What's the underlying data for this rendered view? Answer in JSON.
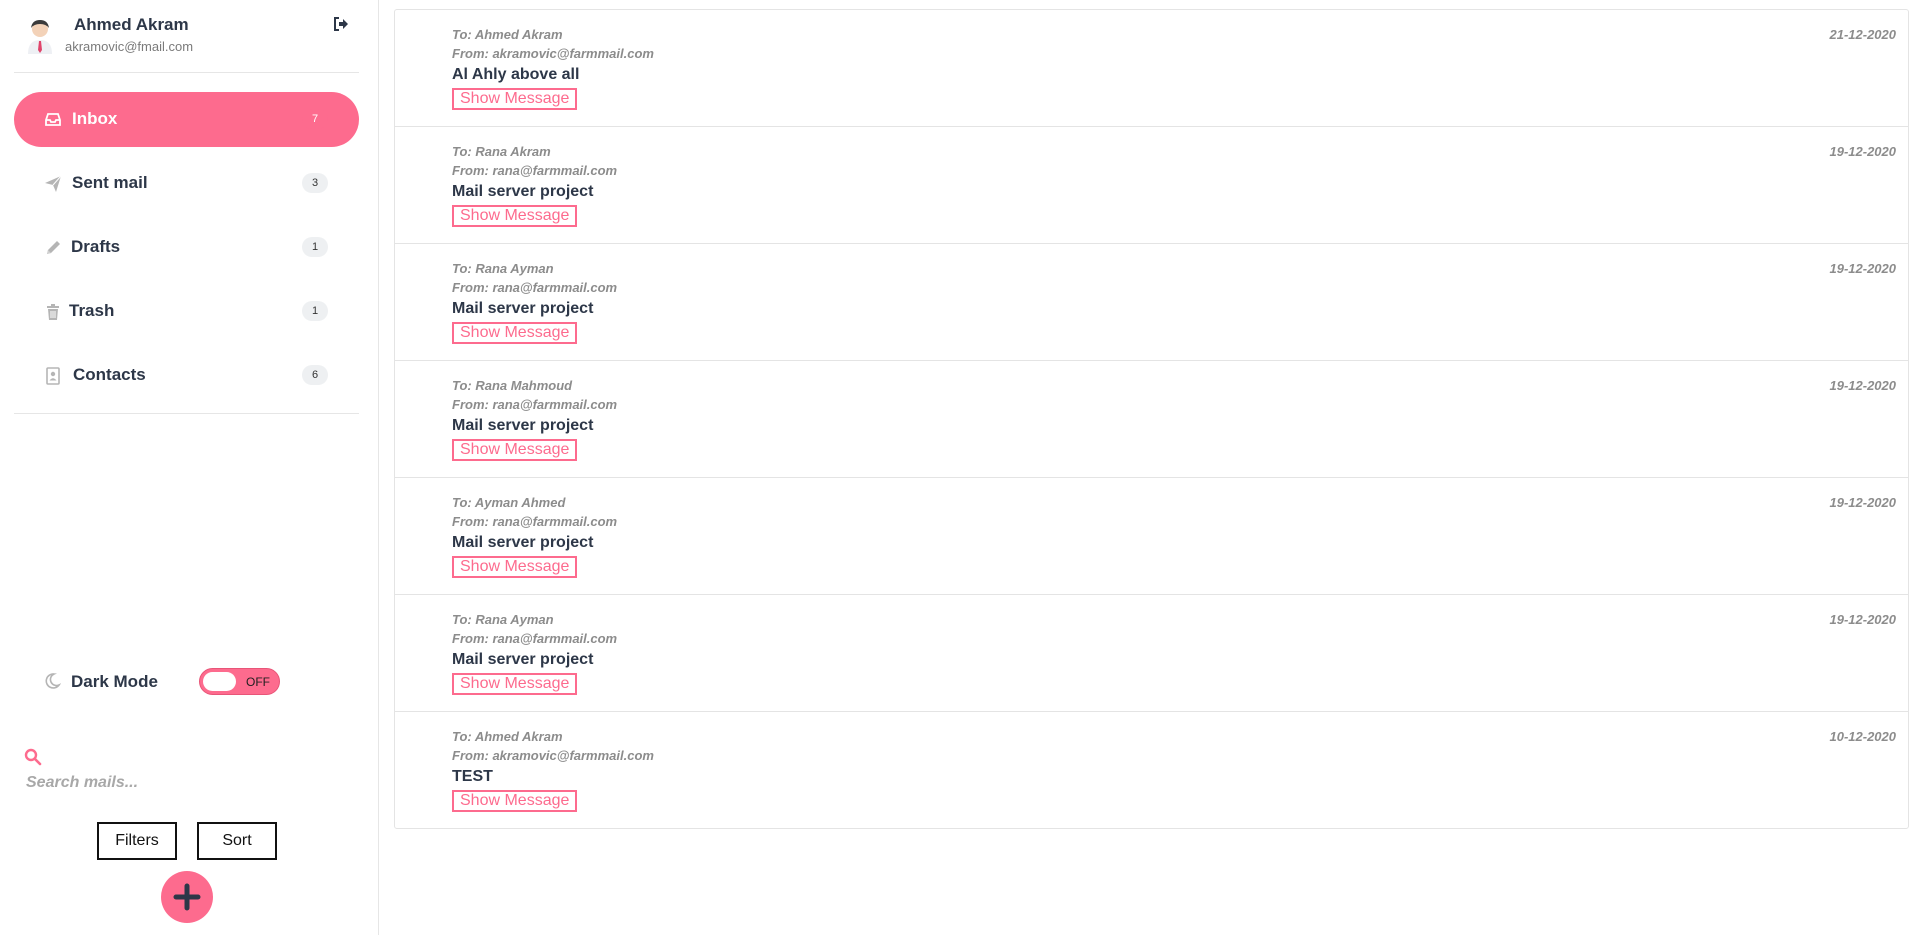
{
  "profile": {
    "name": "Ahmed Akram",
    "email": "akramovic@fmail.com"
  },
  "nav": [
    {
      "label": "Inbox",
      "count": "7",
      "icon": "inbox-icon",
      "active": true
    },
    {
      "label": "Sent mail",
      "count": "3",
      "icon": "paper-plane-icon",
      "active": false
    },
    {
      "label": "Drafts",
      "count": "1",
      "icon": "pencil-icon",
      "active": false
    },
    {
      "label": "Trash",
      "count": "1",
      "icon": "trash-icon",
      "active": false
    },
    {
      "label": "Contacts",
      "count": "6",
      "icon": "contact-card-icon",
      "active": false
    }
  ],
  "dark_mode": {
    "label": "Dark Mode",
    "state": "OFF"
  },
  "search": {
    "placeholder": "Search mails..."
  },
  "buttons": {
    "filters": "Filters",
    "sort": "Sort",
    "compose": "+"
  },
  "mails": [
    {
      "to": "To: Ahmed Akram",
      "from": "From: akramovic@farmmail.com",
      "subject": "Al Ahly above all",
      "date": "21-12-2020",
      "action": "Show Message"
    },
    {
      "to": "To: Rana Akram",
      "from": "From: rana@farmmail.com",
      "subject": "Mail server project",
      "date": "19-12-2020",
      "action": "Show Message"
    },
    {
      "to": "To: Rana Ayman",
      "from": "From: rana@farmmail.com",
      "subject": "Mail server project",
      "date": "19-12-2020",
      "action": "Show Message"
    },
    {
      "to": "To: Rana Mahmoud",
      "from": "From: rana@farmmail.com",
      "subject": "Mail server project",
      "date": "19-12-2020",
      "action": "Show Message"
    },
    {
      "to": "To: Ayman Ahmed",
      "from": "From: rana@farmmail.com",
      "subject": "Mail server project",
      "date": "19-12-2020",
      "action": "Show Message"
    },
    {
      "to": "To: Rana Ayman",
      "from": "From: rana@farmmail.com",
      "subject": "Mail server project",
      "date": "19-12-2020",
      "action": "Show Message"
    },
    {
      "to": "To: Ahmed Akram",
      "from": "From: akramovic@farmmail.com",
      "subject": "TEST",
      "date": "10-12-2020",
      "action": "Show Message"
    }
  ],
  "colors": {
    "accent": "#fd6b8e",
    "text": "#2d3748",
    "muted": "#8c8c8c"
  }
}
